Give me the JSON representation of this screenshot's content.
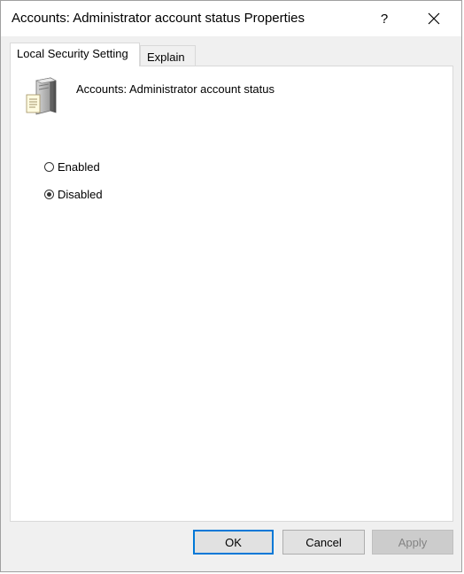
{
  "window": {
    "title": "Accounts: Administrator account status Properties",
    "help_label": "?"
  },
  "tabs": [
    {
      "label": "Local Security Setting",
      "active": true
    },
    {
      "label": "Explain",
      "active": false
    }
  ],
  "policy": {
    "name": "Accounts: Administrator account status",
    "icon": "server-icon"
  },
  "options": [
    {
      "label": "Enabled",
      "selected": false
    },
    {
      "label": "Disabled",
      "selected": true
    }
  ],
  "buttons": {
    "ok": "OK",
    "cancel": "Cancel",
    "apply": "Apply"
  },
  "colors": {
    "dialog_bg": "#f0f0f0",
    "default_button_border": "#0078d7",
    "disabled_text": "#838383"
  }
}
